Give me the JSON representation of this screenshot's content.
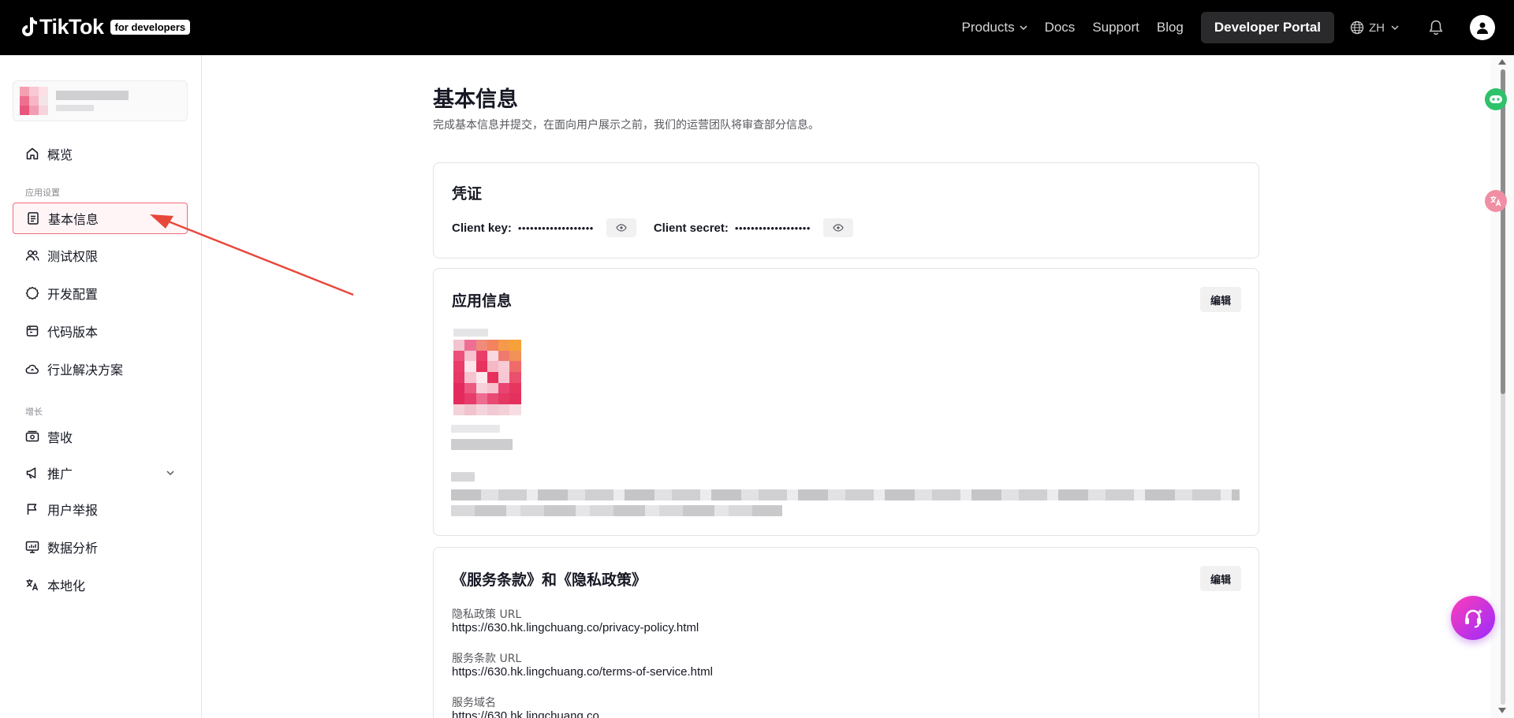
{
  "brand": {
    "wordmark": "TikTok",
    "badge": "for developers"
  },
  "nav": {
    "products": "Products",
    "docs": "Docs",
    "support": "Support",
    "blog": "Blog",
    "portal": "Developer Portal",
    "language": "ZH"
  },
  "sidebar": {
    "overview": "概览",
    "section_app": "应用设置",
    "basic_info": "基本信息",
    "test_perms": "测试权限",
    "dev_config": "开发配置",
    "code_version": "代码版本",
    "industry": "行业解决方案",
    "section_growth": "增长",
    "revenue": "营收",
    "promotion": "推广",
    "user_report": "用户举报",
    "analytics": "数据分析",
    "localization": "本地化"
  },
  "page": {
    "title": "基本信息",
    "subtitle": "完成基本信息并提交，在面向用户展示之前，我们的运营团队将审查部分信息。"
  },
  "credentials": {
    "title": "凭证",
    "client_key_label": "Client key:",
    "client_key_value": "•••••••••••••••••••",
    "client_secret_label": "Client secret:",
    "client_secret_value": "•••••••••••••••••••"
  },
  "app_info": {
    "title": "应用信息",
    "edit": "编辑"
  },
  "policies": {
    "title": "《服务条款》和《隐私政策》",
    "edit": "编辑",
    "privacy_label": "隐私政策 URL",
    "privacy_url": "https://630.hk.lingchuang.co/privacy-policy.html",
    "terms_label": "服务条款 URL",
    "terms_url": "https://630.hk.lingchuang.co/terms-of-service.html",
    "domain_label": "服务域名",
    "domain_value": "https://630.hk.lingchuang.co"
  },
  "colors": {
    "annotation_arrow": "#e8473b",
    "active_border": "#f06a7a",
    "fab_gradient_start": "#ff3db7",
    "fab_gradient_end": "#9a2bff"
  }
}
